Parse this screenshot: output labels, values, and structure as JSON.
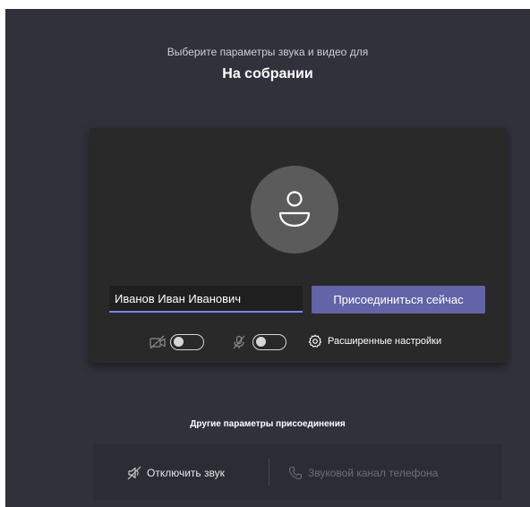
{
  "header": {
    "subtitle": "Выберите параметры звука и видео для",
    "title": "На собрании"
  },
  "preview": {
    "avatar_icon": "person-icon",
    "name_input_value": "Иванов Иван Иванович",
    "join_button_label": "Присоединиться сейчас",
    "camera": {
      "icon": "camera-off-icon",
      "enabled": false
    },
    "microphone": {
      "icon": "mic-off-icon",
      "enabled": false
    },
    "advanced_settings_label": "Расширенные настройки",
    "advanced_settings_icon": "gear-icon"
  },
  "other_options": {
    "title": "Другие параметры присоединения",
    "mute_label": "Отключить звук",
    "mute_icon": "speaker-off-icon",
    "phone_audio_label": "Звуковой канал телефона",
    "phone_audio_icon": "phone-icon"
  },
  "colors": {
    "background": "#31313c",
    "preview_background": "#292929",
    "accent": "#6264a7",
    "input_underline": "#7b83eb",
    "disabled_text": "#6e6e78"
  }
}
